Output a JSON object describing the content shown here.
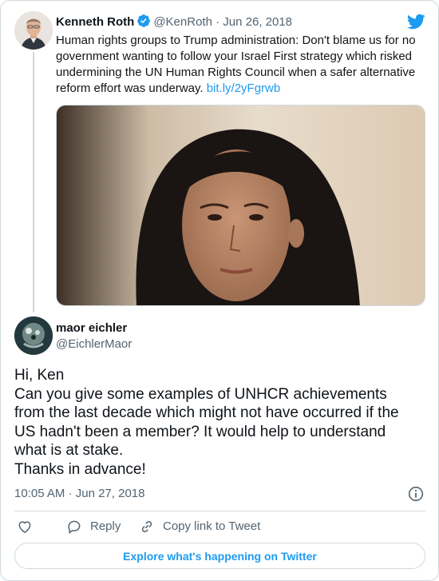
{
  "parent_tweet": {
    "author_name": "Kenneth Roth",
    "author_handle": "@KenRoth",
    "separator": "·",
    "date": "Jun 26, 2018",
    "text": "Human rights groups to Trump administration: Don't blame us for no government wanting to follow your Israel First strategy which risked undermining the UN Human Rights Council when a safer alternative reform effort was underway.",
    "link": "bit.ly/2yFgrwb"
  },
  "reply_tweet": {
    "author_name": "maor eichler",
    "author_handle": "@EichlerMaor",
    "lines": [
      "Hi, Ken",
      "Can you give some examples of UNHCR achievements",
      "from the last decade which might not have occurred if the",
      "US hadn't been a member? It would help to understand",
      "what is at stake.",
      "Thanks in advance!"
    ],
    "time": "10:05 AM",
    "separator": "·",
    "date": "Jun 27, 2018"
  },
  "actions": {
    "reply_label": "Reply",
    "copy_label": "Copy link to Tweet"
  },
  "explore_label": "Explore what's happening on Twitter",
  "icons": {
    "verified": "verified-badge-icon",
    "brand": "twitter-bird-icon",
    "like": "heart-icon",
    "reply": "speech-bubble-icon",
    "copy": "link-icon",
    "info": "info-icon"
  },
  "colors": {
    "accent": "#1d9bf0",
    "text": "#0f1419",
    "secondary": "#536471",
    "border": "#cfd9de"
  }
}
